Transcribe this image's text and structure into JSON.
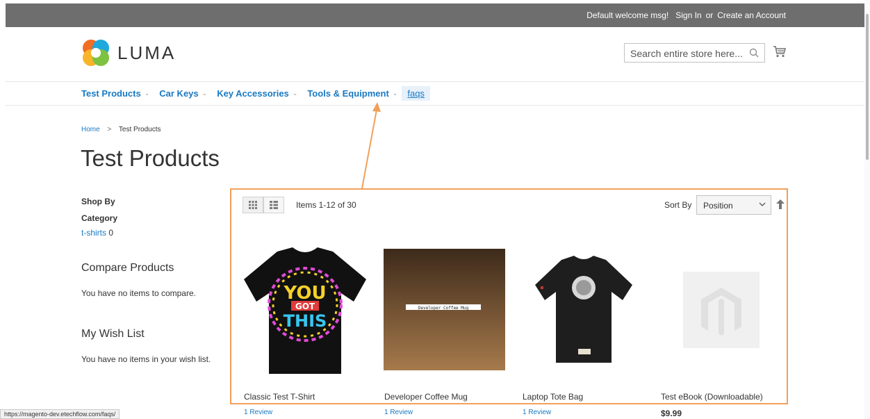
{
  "top_panel": {
    "welcome": "Default welcome msg!",
    "sign_in": "Sign In",
    "or": "or",
    "create_account": "Create an Account"
  },
  "header": {
    "logo_text": "LUMA",
    "search_placeholder": "Search entire store here...",
    "icons": [
      "search-icon",
      "cart-icon"
    ]
  },
  "nav": {
    "items": [
      {
        "label": "Test Products",
        "has_children": true
      },
      {
        "label": "Car Keys",
        "has_children": true
      },
      {
        "label": "Key Accessories",
        "has_children": true
      },
      {
        "label": "Tools & Equipment",
        "has_children": true
      },
      {
        "label": "faqs",
        "has_children": false
      }
    ]
  },
  "breadcrumb": {
    "home": "Home",
    "current": "Test Products"
  },
  "page_title": "Test Products",
  "sidebar": {
    "shop_by": "Shop By",
    "category_title": "Category",
    "category_item": "t-shirts",
    "category_count": "0",
    "compare_title": "Compare Products",
    "compare_empty": "You have no items to compare.",
    "wishlist_title": "My Wish List",
    "wishlist_empty": "You have no items in your wish list."
  },
  "toolbar": {
    "amount": "Items 1-12 of 30",
    "sort_label": "Sort By",
    "sort_value": "Position"
  },
  "products": [
    {
      "name": "Classic Test T-Shirt",
      "review": "1 Review"
    },
    {
      "name": "Developer Coffee Mug",
      "review": "1 Review",
      "image_text": "Developer Coffee Mug"
    },
    {
      "name": "Laptop Tote Bag",
      "review": "1 Review"
    },
    {
      "name": "Test eBook (Downloadable)",
      "price": "$9.99"
    }
  ],
  "status_url": "https://magento-dev.etechflow.com/faqs/",
  "colors": {
    "top_panel": "#6e6e6e",
    "link": "#1979c3",
    "annotation": "#f0a05a",
    "mug_gradient_top": "#3d2a1a",
    "mug_gradient_bottom": "#a67a4c"
  }
}
